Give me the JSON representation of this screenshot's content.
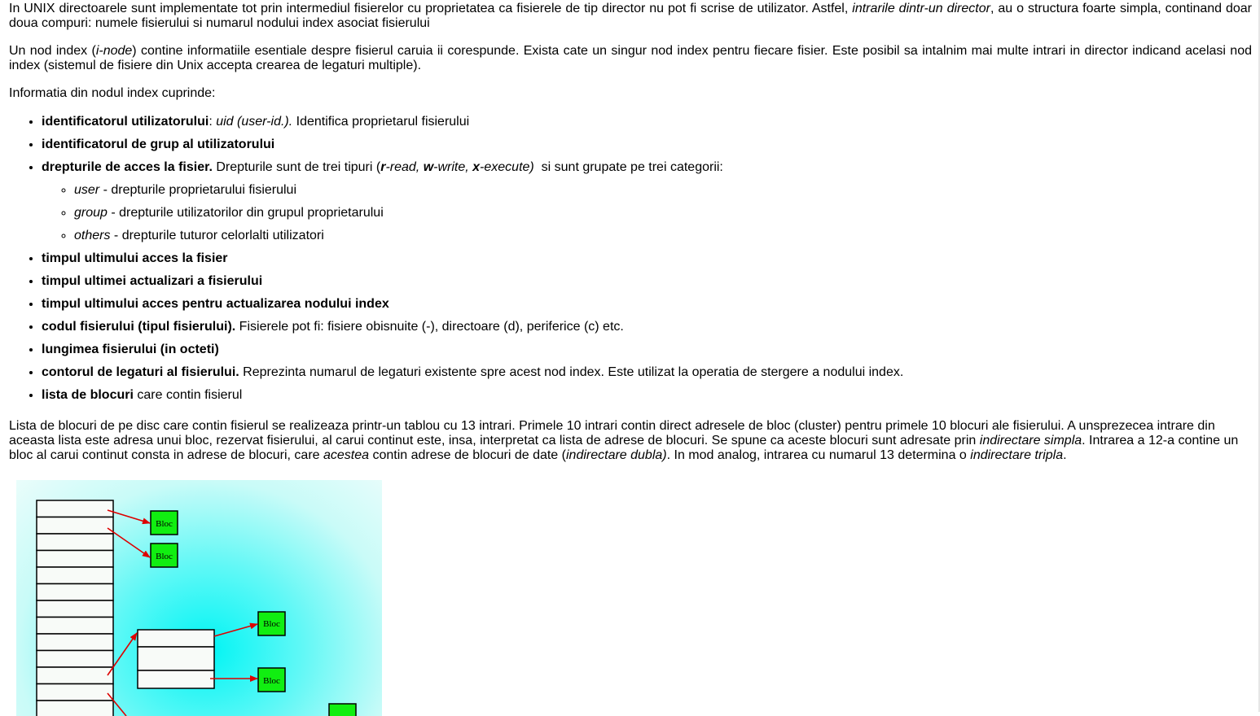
{
  "intro": {
    "t1": "In UNIX directoarele sunt implementate tot prin intermediul fisierelor cu proprietatea ca fisierele de tip director nu pot fi scrise de utilizator. Astfel, ",
    "em1": "intrarile dintr-un director",
    "t2": ", au o structura foarte simpla, continand doar doua compuri: numele fisierului si numarul nodului index asociat fisierului"
  },
  "para2": {
    "t1": "Un nod index (",
    "em1": "i-node",
    "t2": ") contine informatiile esentiale despre fisierul caruia ii corespunde. Exista cate un singur nod index pentru fiecare fisier. Este posibil sa intalnim mai multe intrari in director indicand acelasi nod index (sistemul de fisiere din Unix accepta crearea de legaturi multiple)."
  },
  "lead": "Informatia din nodul index cuprinde:",
  "list": {
    "item1": {
      "bold": "identificatorul utilizatorului",
      "colon": ": ",
      "em": "uid (user-id.).",
      "rest": " Identifica proprietarul fisierului"
    },
    "item2": {
      "bold": "identificatorul de grup al utilizatorului"
    },
    "item3": {
      "bold": "drepturile de acces la fisier.",
      "t1": " Drepturile sunt de trei tipuri (",
      "r": "r",
      "read": "-read, ",
      "w": "w",
      "write": "-write, ",
      "x": "x",
      "exec": "-execute)",
      "t2": "  si sunt grupate pe trei categorii:",
      "sub": [
        {
          "em": "user",
          "rest": " - drepturile proprietarului fisierului"
        },
        {
          "em": "group",
          "rest": " - drepturile utilizatorilor din grupul proprietarului"
        },
        {
          "em": "others",
          "rest": " - drepturile tuturor celorlalti utilizatori"
        }
      ]
    },
    "item4": {
      "bold": "timpul ultimului acces la fisier"
    },
    "item5": {
      "bold": "timpul ultimei actualizari a fisierului"
    },
    "item6": {
      "bold": "timpul ultimului acces pentru actualizarea nodului index"
    },
    "item7": {
      "bold": "codul fisierului (tipul fisierului).",
      "rest": " Fisierele pot fi: fisiere obisnuite (-), directoare (d), periferice (c) etc."
    },
    "item8": {
      "bold": "lungimea fisierului (in octeti)"
    },
    "item9": {
      "bold": "contorul de legaturi al fisierului.",
      "rest": " Reprezinta numarul de legaturi existente spre acest nod index. Este utilizat la operatia de stergere a nodului index."
    },
    "item10": {
      "bold": "lista de blocuri",
      "rest": " care contin fisierul"
    }
  },
  "blocks": {
    "t1": "Lista de blocuri de pe disc care contin fisierul se realizeaza printr-un tablou cu 13 intrari. Primele 10 intrari contin direct adresele de bloc (cluster) pentru primele 10 blocuri ale fisierului. A unsprezecea intrare din aceasta lista este adresa unui bloc, rezervat fisierului, al carui continut este, insa, interpretat ca lista de adrese de blocuri. Se spune ca aceste blocuri sunt adresate prin ",
    "em1": "indirectare simpla",
    "t2": ". Intrarea a 12-a contine un bloc al carui continut consta in adrese de blocuri, care ",
    "em2": "acestea",
    "t3": " contin adrese de blocuri de date (",
    "em3": "indirectare dubla)",
    "t4": ". In mod analog, intrarea cu numarul 13 determina o ",
    "em4": "indirectare tripla",
    "t5": "."
  },
  "figure": {
    "block_label": "Bloc",
    "colors": {
      "block_fill": "#11ee11",
      "arrow": "#dd0000",
      "cell_fill": "#f8fbf8",
      "bg_center": "#00f4f4",
      "bg_edge": "#eafdfb"
    }
  }
}
